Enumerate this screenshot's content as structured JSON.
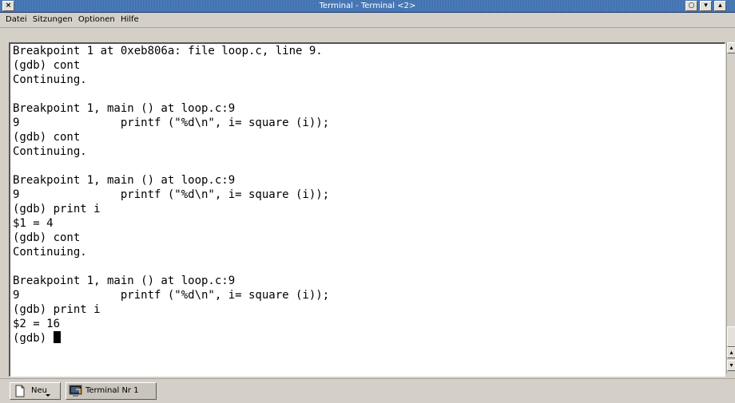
{
  "window": {
    "title": "Terminal - Terminal <2>",
    "close_glyph": "×",
    "buttons": [
      "○",
      "▾",
      "▴"
    ]
  },
  "menu": [
    "Datei",
    "Sitzungen",
    "Optionen",
    "Hilfe"
  ],
  "terminal": {
    "lines": [
      "Breakpoint 1 at 0xeb806a: file loop.c, line 9.",
      "(gdb) cont",
      "Continuing.",
      "",
      "Breakpoint 1, main () at loop.c:9",
      "9               printf (\"%d\\n\", i= square (i));",
      "(gdb) cont",
      "Continuing.",
      "",
      "Breakpoint 1, main () at loop.c:9",
      "9               printf (\"%d\\n\", i= square (i));",
      "(gdb) print i",
      "$1 = 4",
      "(gdb) cont",
      "Continuing.",
      "",
      "Breakpoint 1, main () at loop.c:9",
      "9               printf (\"%d\\n\", i= square (i));",
      "(gdb) print i",
      "$2 = 16",
      "(gdb) "
    ]
  },
  "scrollbar": {
    "up_glyph": "▴",
    "down_glyph": "▾"
  },
  "tabs": {
    "new_label": "Neu",
    "session_label": "Terminal Nr 1"
  },
  "colors": {
    "titlebar": "#3d6fb0",
    "terminal_bg": "#ffffff",
    "chrome": "#d4d0c8"
  }
}
